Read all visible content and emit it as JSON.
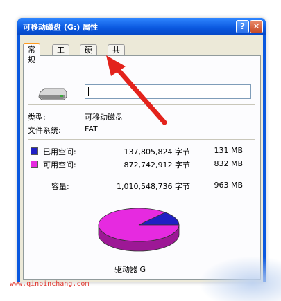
{
  "window": {
    "title": "可移动磁盘 (G:) 属性",
    "help_label": "?",
    "close_label": "✕"
  },
  "tabs": [
    "常规",
    "工具",
    "硬件",
    "共享"
  ],
  "general": {
    "name_value": "",
    "type_label": "类型:",
    "type_value": "可移动磁盘",
    "fs_label": "文件系统:",
    "fs_value": "FAT",
    "used_label": "已用空间:",
    "used_bytes": "137,805,824 字节",
    "used_mb": "131 MB",
    "free_label": "可用空间:",
    "free_bytes": "872,742,912 字节",
    "free_mb": "832 MB",
    "capacity_label": "容量:",
    "capacity_bytes": "1,010,548,736 字节",
    "capacity_mb": "963 MB",
    "drive_label": "驱动器 G"
  },
  "colors": {
    "used": "#1f1fc4",
    "free": "#e62ae0",
    "arrow": "#e3231c"
  },
  "chart_data": {
    "type": "pie",
    "labels": [
      "已用空间",
      "可用空间"
    ],
    "values": [
      137805824,
      872742912
    ]
  },
  "watermark": "www.qinpinchang.com"
}
